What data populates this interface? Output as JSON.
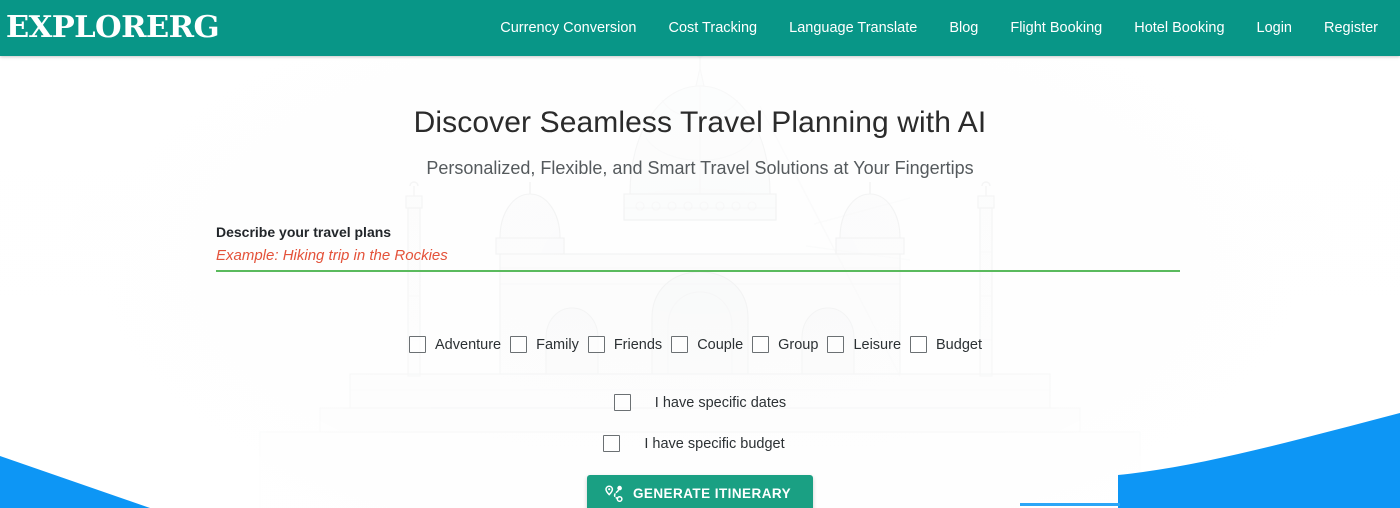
{
  "header": {
    "logo": "EXPLORERG",
    "nav": [
      {
        "label": "Currency Conversion"
      },
      {
        "label": "Cost Tracking"
      },
      {
        "label": "Language Translate"
      },
      {
        "label": "Blog"
      },
      {
        "label": "Flight Booking"
      },
      {
        "label": "Hotel Booking"
      },
      {
        "label": "Login"
      },
      {
        "label": "Register"
      }
    ]
  },
  "hero": {
    "title": "Discover Seamless Travel Planning with AI",
    "subtitle": "Personalized, Flexible, and Smart Travel Solutions at Your Fingertips",
    "background": "taj-mahal-monument-watermark"
  },
  "form": {
    "field_label": "Describe your travel plans",
    "input_value": "",
    "input_placeholder": "Example: Hiking trip in the Rockies",
    "tags": [
      {
        "label": "Adventure",
        "checked": false
      },
      {
        "label": "Family",
        "checked": false
      },
      {
        "label": "Friends",
        "checked": false
      },
      {
        "label": "Couple",
        "checked": false
      },
      {
        "label": "Group",
        "checked": false
      },
      {
        "label": "Leisure",
        "checked": false
      },
      {
        "label": "Budget",
        "checked": false
      }
    ],
    "options": [
      {
        "label": "I have specific dates",
        "checked": false
      },
      {
        "label": "I have specific budget",
        "checked": false
      }
    ],
    "submit_label": "GENERATE ITINERARY",
    "submit_icon": "route-icon"
  },
  "colors": {
    "header_green": "#089687",
    "button_green": "#1aa083",
    "underline_green": "#5aba5d",
    "placeholder_red": "#e4523a",
    "accent_blue": "#0d96f5",
    "page_background": "#fdfdfd"
  }
}
